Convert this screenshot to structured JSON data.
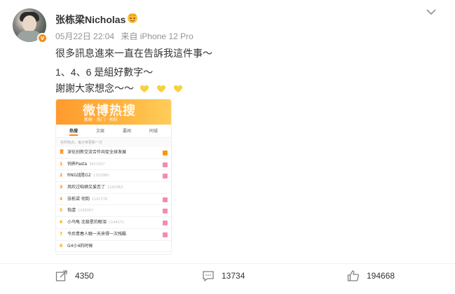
{
  "post": {
    "username": "张栋梁Nicholas",
    "verified_badge": "v",
    "timestamp": "05月22日 22:04",
    "source": "来自 iPhone 12 Pro",
    "lines": [
      "很多訊息進來一直在告訴我這件事～",
      "1、4、6 是組好數字～",
      "謝謝大家想念～～"
    ],
    "hearts_icon": "yellow-heart-icon",
    "heart_color": "#f7d23e"
  },
  "screenshot": {
    "banner_title": "微博热搜",
    "banner_sub": "新鲜 · 热门 · 有料",
    "tabs": [
      "热搜",
      "文娱",
      "要闻",
      "同城"
    ],
    "note": "实时热点，每分钟更新一次",
    "rows": [
      {
        "rank": "置",
        "title": "深化创新交流合作共促全球发展",
        "heat": ""
      },
      {
        "rank": "1",
        "title": "饲养Pasta",
        "heat": "3921507"
      },
      {
        "rank": "2",
        "title": "RNG战胜G2",
        "heat": "1331080"
      },
      {
        "rank": "3",
        "title": "风吹过咱俩又爱恋了",
        "heat": "1192963"
      },
      {
        "rank": "4",
        "title": "张栋梁 何韵",
        "heat": "1191776"
      },
      {
        "rank": "5",
        "title": "恢虐",
        "heat": "1145057"
      },
      {
        "rank": "6",
        "title": "小乌龟 北极星的眼泪",
        "heat": "1144271"
      },
      {
        "rank": "7",
        "title": "今后青春人眼一天来得一次残酷",
        "heat": ""
      },
      {
        "rank": "8",
        "title": "G4小4的时候",
        "heat": ""
      }
    ]
  },
  "actions": {
    "share_count": "4350",
    "comment_count": "13734",
    "like_count": "194668"
  },
  "colors": {
    "accent": "#ff8200",
    "meta": "#939393"
  }
}
